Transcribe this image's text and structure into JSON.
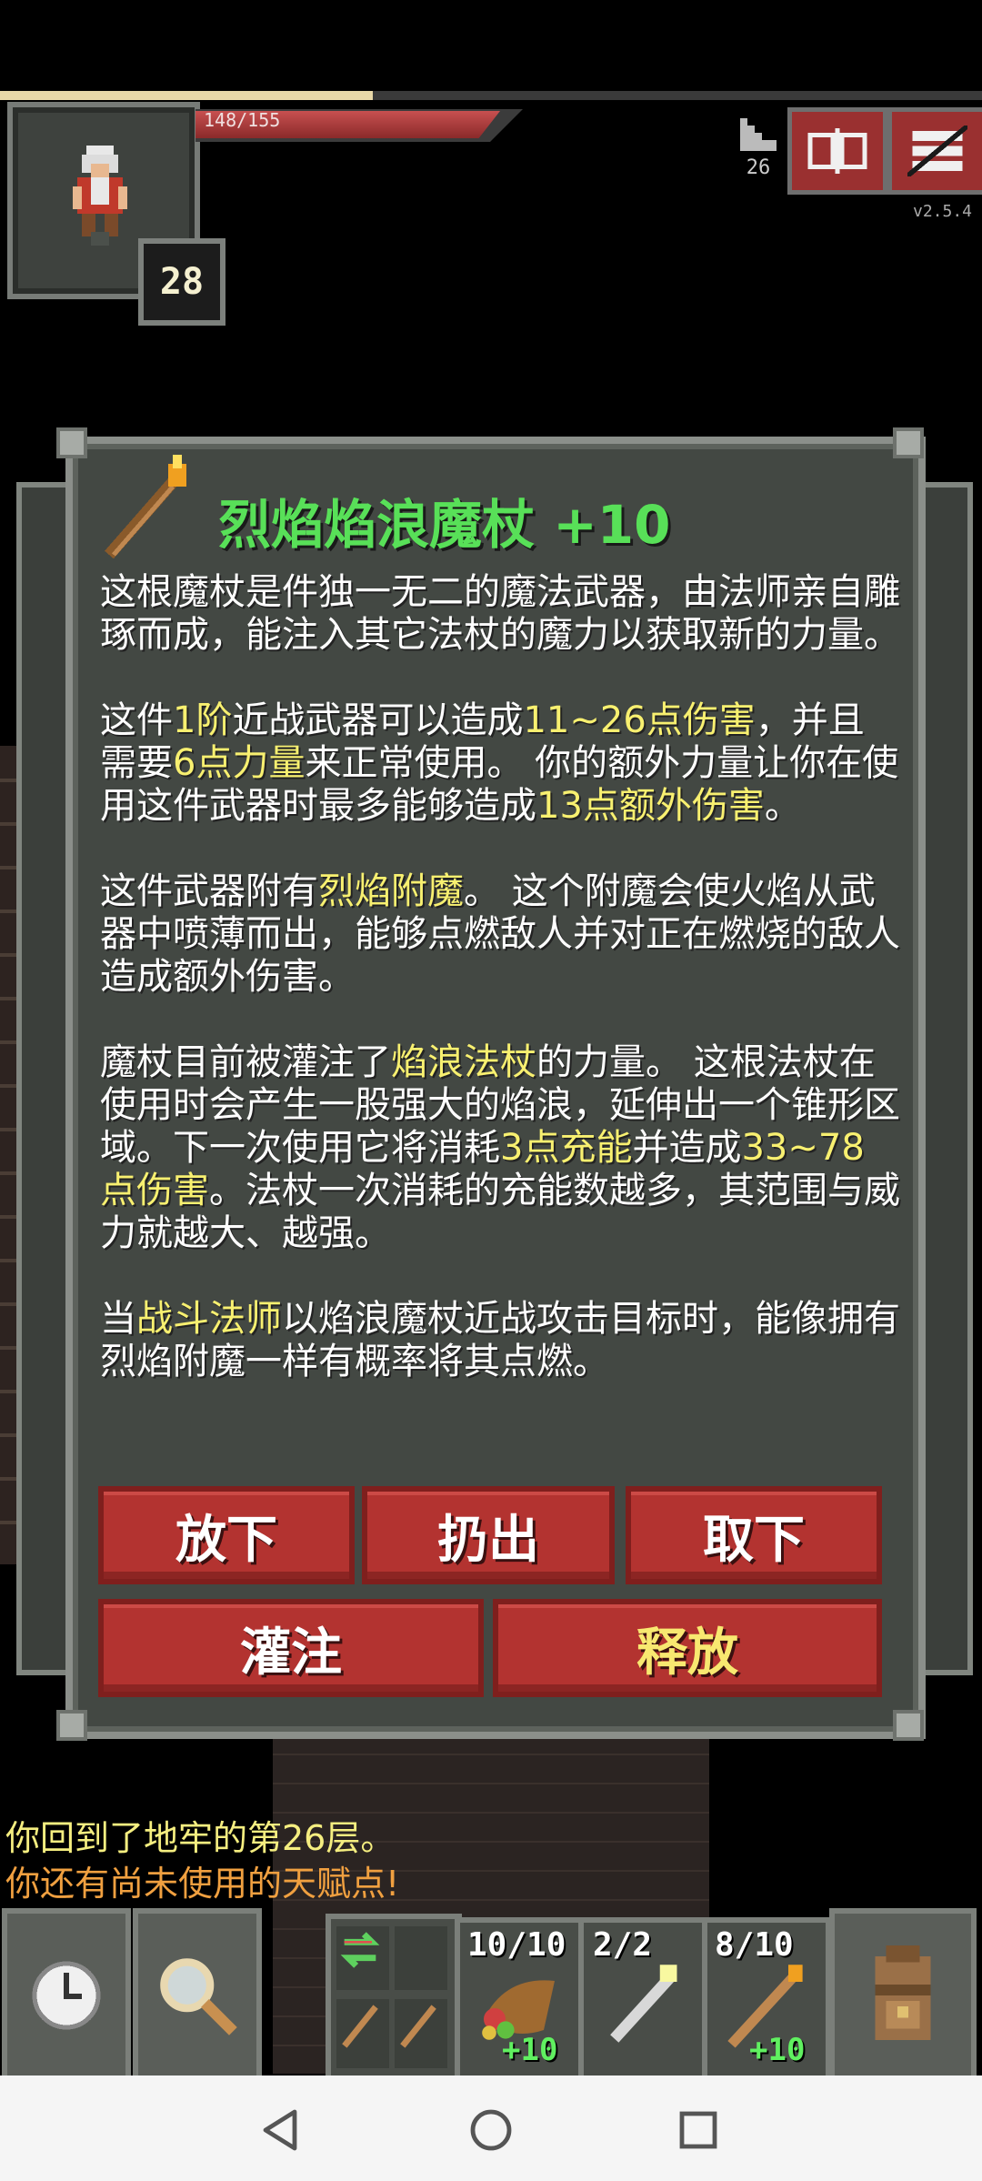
{
  "status": {
    "hp_text": "148/155",
    "hp_fraction": 0.955,
    "xp_fraction": 0.38,
    "level": "28",
    "depth": "26",
    "version": "v2.5.4"
  },
  "item_window": {
    "title": "烈焰焰浪魔杖 +10",
    "paragraphs": [
      [
        {
          "t": "这根魔杖是件独一无二的魔法武器，由法师亲自雕琢而成，能注入其它法杖的魔力以获取新的力量。",
          "h": false
        }
      ],
      [
        {
          "t": "这件",
          "h": false
        },
        {
          "t": "1阶",
          "h": true
        },
        {
          "t": "近战武器可以造成",
          "h": false
        },
        {
          "t": "11~26点伤害",
          "h": true
        },
        {
          "t": "，并且需要",
          "h": false
        },
        {
          "t": "6点力量",
          "h": true
        },
        {
          "t": "来正常使用。 你的额外力量让你在使用这件武器时最多能够造成",
          "h": false
        },
        {
          "t": "13点额外伤害",
          "h": true
        },
        {
          "t": "。",
          "h": false
        }
      ],
      [
        {
          "t": "这件武器附有",
          "h": false
        },
        {
          "t": "烈焰附魔",
          "h": true
        },
        {
          "t": "。 这个附魔会使火焰从武器中喷薄而出，能够点燃敌人并对正在燃烧的敌人造成额外伤害。",
          "h": false
        }
      ],
      [
        {
          "t": "魔杖目前被灌注了",
          "h": false
        },
        {
          "t": "焰浪法杖",
          "h": true
        },
        {
          "t": "的力量。 这根法杖在使用时会产生一股强大的焰浪，延伸出一个锥形区域。下一次使用它将消耗",
          "h": false
        },
        {
          "t": "3点充能",
          "h": true
        },
        {
          "t": "并造成",
          "h": false
        },
        {
          "t": "33~78点伤害",
          "h": true
        },
        {
          "t": "。法杖一次消耗的充能数越多，其范围与威力就越大、越强。",
          "h": false
        }
      ],
      [
        {
          "t": "当",
          "h": false
        },
        {
          "t": "战斗法师",
          "h": true
        },
        {
          "t": "以焰浪魔杖近战攻击目标时，能像拥有烈焰附魔一样有概率将其点燃。",
          "h": false
        }
      ]
    ],
    "buttons": {
      "drop": "放下",
      "throw": "扔出",
      "unequip": "取下",
      "imbue": "灌注",
      "release": "释放"
    }
  },
  "log": {
    "line1": "你回到了地牢的第26层。",
    "line2": "你还有尚未使用的天赋点!"
  },
  "quickslots": [
    {
      "count": "10/10",
      "upgrade": "+10",
      "icon": "cornucopia-icon"
    },
    {
      "count": "2/2",
      "upgrade": "",
      "icon": "wand-icon"
    },
    {
      "count": "8/10",
      "upgrade": "+10",
      "icon": "staff-icon"
    }
  ],
  "colors": {
    "title": "#58e058",
    "highlight": "#f8f070",
    "button": "#b33330",
    "log_info": "#f5ee80",
    "log_warning": "#f0a040"
  }
}
